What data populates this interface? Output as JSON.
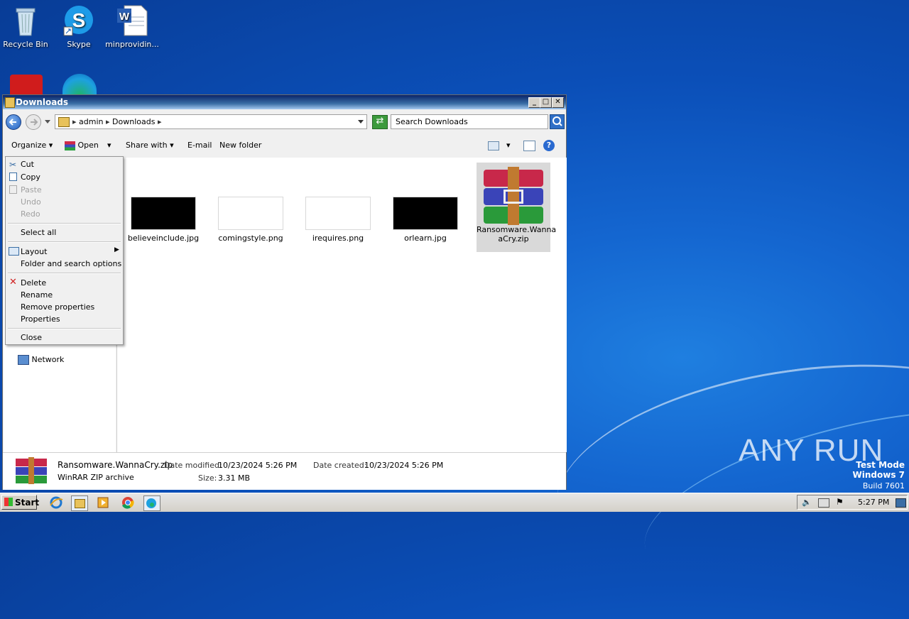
{
  "desktop": {
    "icons": [
      {
        "label": "Recycle Bin"
      },
      {
        "label": "Skype"
      },
      {
        "label": "minprovidin..."
      }
    ],
    "watermark_brand": "ANY RUN",
    "os_line1": "Test Mode",
    "os_line2": "Windows 7",
    "os_line3": "Build 7601"
  },
  "window": {
    "title": "Downloads",
    "minimize": "_",
    "maximize": "□",
    "close": "✕",
    "breadcrumb": [
      "admin",
      "Downloads"
    ],
    "search_placeholder": "Search Downloads",
    "toolbar": {
      "organize": "Organize",
      "open": "Open",
      "share_with": "Share with",
      "email": "E-mail",
      "new_folder": "New folder"
    },
    "nav": {
      "network": "Network"
    },
    "files": [
      {
        "name": "believeinclude.jpg"
      },
      {
        "name": "comingstyle.png"
      },
      {
        "name": "irequires.png"
      },
      {
        "name": "orlearn.jpg"
      },
      {
        "name": "Ransomware.WannaCry.zip",
        "line1": "Ransomware.Wanna",
        "line2": "aCry.zip"
      }
    ],
    "details": {
      "name": "Ransomware.WannaCry.zip",
      "type": "WinRAR ZIP archive",
      "date_modified_label": "Date modified:",
      "date_modified": "10/23/2024 5:26 PM",
      "size_label": "Size:",
      "size": "3.31 MB",
      "date_created_label": "Date created:",
      "date_created": "10/23/2024 5:26 PM"
    }
  },
  "context_menu": {
    "cut": "Cut",
    "copy": "Copy",
    "paste": "Paste",
    "undo": "Undo",
    "redo": "Redo",
    "select_all": "Select all",
    "layout": "Layout",
    "folder_options": "Folder and search options",
    "delete": "Delete",
    "rename": "Rename",
    "remove_properties": "Remove properties",
    "properties": "Properties",
    "close": "Close"
  },
  "taskbar": {
    "start": "Start",
    "clock": "5:27 PM"
  }
}
